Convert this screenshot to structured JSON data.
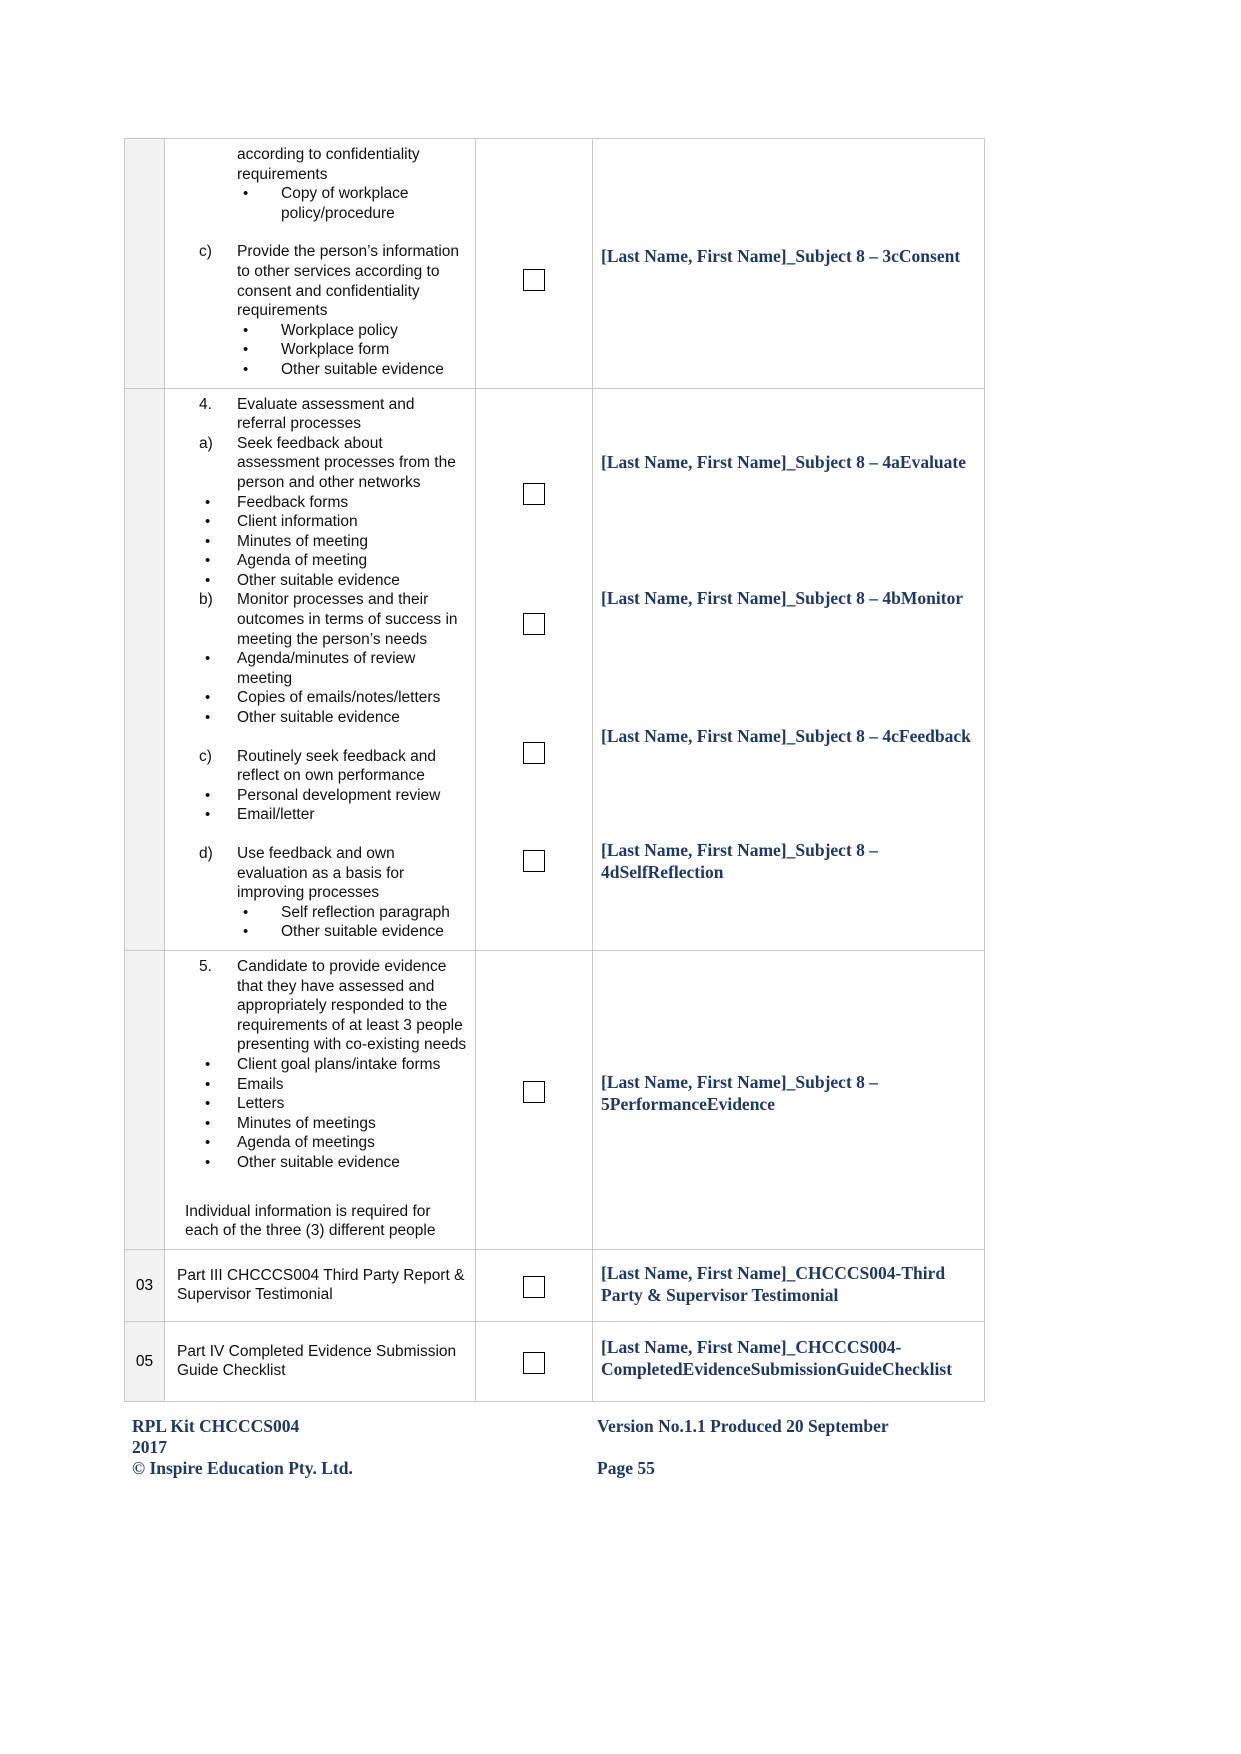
{
  "document": {
    "title": "RPL Kit CHCCCS004 Evidence Submission Guide Checklist",
    "accent_color": "#1f3864",
    "num_cell_bg": "#f2f2f2"
  },
  "table": {
    "rows": [
      {
        "num": "",
        "checkbox_count": 1,
        "items": [
          {
            "type": "cont",
            "marker": "",
            "text": "according to confidentiality"
          },
          {
            "type": "cont",
            "marker": "",
            "text": "requirements"
          },
          {
            "type": "b2",
            "marker": "•",
            "text": "Copy of workplace policy/procedure"
          },
          {
            "type": "gap",
            "marker": "",
            "text": ""
          },
          {
            "type": "alpha",
            "marker": "c)",
            "text": "Provide the person’s information to other services according to consent and confidentiality requirements"
          },
          {
            "type": "b2",
            "marker": "•",
            "text": "Workplace policy"
          },
          {
            "type": "b2",
            "marker": "•",
            "text": "Workplace form"
          },
          {
            "type": "b2",
            "marker": "•",
            "text": "Other suitable evidence"
          }
        ],
        "filename": "[Last Name, First Name]_Subject 8 – 3cConsent"
      },
      {
        "num": "",
        "checkbox_count": 4,
        "items": [
          {
            "type": "alpha",
            "marker": "4.",
            "text": "Evaluate assessment and referral processes"
          },
          {
            "type": "alpha",
            "marker": "a)",
            "text": "Seek feedback about assessment processes from the person and other networks"
          },
          {
            "type": "b1",
            "marker": "•",
            "text": "Feedback forms"
          },
          {
            "type": "b1",
            "marker": "•",
            "text": "Client information"
          },
          {
            "type": "b1",
            "marker": "•",
            "text": "Minutes of meeting"
          },
          {
            "type": "b1",
            "marker": "•",
            "text": "Agenda of meeting"
          },
          {
            "type": "b1",
            "marker": "•",
            "text": "Other suitable evidence"
          },
          {
            "type": "alpha",
            "marker": "b)",
            "text": "Monitor processes and their outcomes in terms of success in meeting the person’s needs"
          },
          {
            "type": "b1",
            "marker": "•",
            "text": "Agenda/minutes of review meeting"
          },
          {
            "type": "b1",
            "marker": "•",
            "text": "Copies of emails/notes/letters"
          },
          {
            "type": "b1",
            "marker": "•",
            "text": "Other suitable evidence"
          },
          {
            "type": "gap",
            "marker": "",
            "text": ""
          },
          {
            "type": "alpha",
            "marker": "c)",
            "text": "Routinely seek feedback and reflect on own performance"
          },
          {
            "type": "b1",
            "marker": "•",
            "text": "Personal development review"
          },
          {
            "type": "b1",
            "marker": "•",
            "text": "Email/letter"
          },
          {
            "type": "gap",
            "marker": "",
            "text": ""
          },
          {
            "type": "alpha",
            "marker": "d)",
            "text": "Use feedback and own evaluation as a basis for improving processes"
          },
          {
            "type": "b2",
            "marker": "•",
            "text": "Self reflection paragraph"
          },
          {
            "type": "b2",
            "marker": "•",
            "text": "Other suitable evidence"
          }
        ],
        "filenames": [
          "[Last Name, First Name]_Subject 8 – 4aEvaluate",
          "[Last Name, First Name]_Subject 8 – 4bMonitor",
          "[Last Name, First Name]_Subject 8 – 4cFeedback",
          "[Last Name, First Name]_Subject 8 – 4dSelfReflection"
        ]
      },
      {
        "num": "",
        "checkbox_count": 1,
        "items": [
          {
            "type": "alpha",
            "marker": "5.",
            "text": "Candidate to provide evidence that they have assessed and appropriately responded to the requirements of at least 3 people presenting with co-existing needs"
          },
          {
            "type": "b1",
            "marker": "•",
            "text": "Client goal plans/intake forms"
          },
          {
            "type": "b1",
            "marker": "•",
            "text": "Emails"
          },
          {
            "type": "b1",
            "marker": "•",
            "text": "Letters"
          },
          {
            "type": "b1",
            "marker": "•",
            "text": "Minutes of meetings"
          },
          {
            "type": "b1",
            "marker": "•",
            "text": "Agenda of meetings"
          },
          {
            "type": "b1",
            "marker": "•",
            "text": "Other suitable evidence"
          },
          {
            "type": "gap",
            "marker": "",
            "text": ""
          },
          {
            "type": "plain",
            "marker": "",
            "text": "Individual information is required for each of the three (3) different people"
          }
        ],
        "filename": "[Last Name, First Name]_Subject 8 – 5PerformanceEvidence"
      },
      {
        "num": "03",
        "checkbox_count": 1,
        "text": "Part III CHCCCS004 Third Party Report & Supervisor Testimonial",
        "filename": "[Last Name, First Name]_CHCCCS004-Third Party & Supervisor Testimonial"
      },
      {
        "num": "05",
        "checkbox_count": 1,
        "text": "Part IV Completed Evidence Submission Guide Checklist",
        "filename": "[Last Name, First Name]_CHCCCS004-CompletedEvidenceSubmissionGuideChecklist"
      }
    ]
  },
  "footer": {
    "line1_left": "RPL Kit CHCCCS004",
    "line1_right": "Version No.1.1 Produced 20 September",
    "line2_left": "2017",
    "line3_left": "© Inspire Education Pty. Ltd.",
    "line3_right": "Page 55"
  }
}
